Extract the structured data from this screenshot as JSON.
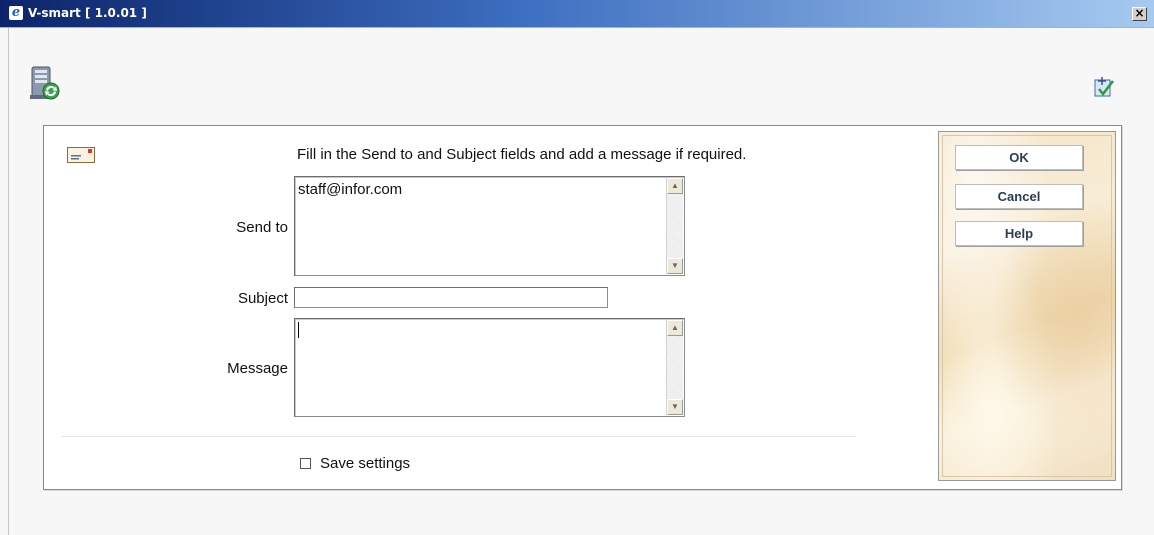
{
  "window": {
    "title": "V-smart [ 1.0.01 ]",
    "close_glyph": "×"
  },
  "icons": {
    "server": "server-sync-icon",
    "process": "process-check-icon",
    "mail": "envelope-icon"
  },
  "form": {
    "instruction": "Fill in the Send to and Subject fields and add a message if required.",
    "send_to_label": "Send to",
    "send_to_value": "staff@infor.com",
    "subject_label": "Subject",
    "subject_value": "",
    "message_label": "Message",
    "message_value": "",
    "save_settings_label": "Save settings",
    "save_settings_checked": false
  },
  "buttons": {
    "ok": "OK",
    "cancel": "Cancel",
    "help": "Help"
  }
}
